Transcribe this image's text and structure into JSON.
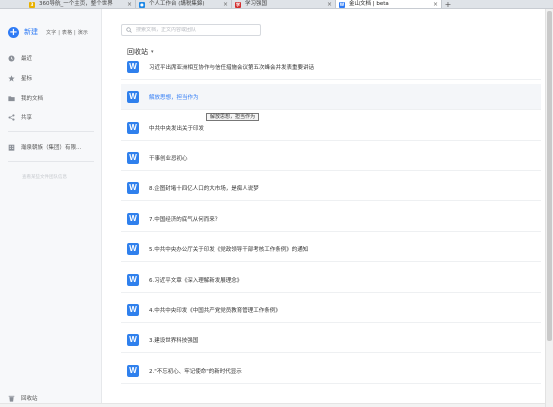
{
  "tabs": [
    {
      "title": "360导航_一个主页，整个世界",
      "active": false,
      "favicon_color": "#e9b100"
    },
    {
      "title": "个人工作台 (講税集錦)",
      "active": false,
      "favicon_color": "#1e88e5"
    },
    {
      "title": "学习强国",
      "active": false,
      "favicon_color": "#d32f2f"
    },
    {
      "title": "金山文档 | beta",
      "active": true,
      "favicon_color": "#2f7bf5"
    }
  ],
  "sidebar": {
    "new_label": "新建",
    "new_sub": "文字 | 表格 | 演示",
    "nav": [
      {
        "label": "最近",
        "icon": "clock-icon"
      },
      {
        "label": "星标",
        "icon": "star-icon"
      },
      {
        "label": "我的文档",
        "icon": "folder-icon"
      },
      {
        "label": "共享",
        "icon": "share-icon"
      }
    ],
    "team": {
      "label": "瀚泉朝族（集团）有限...",
      "icon": "building-icon"
    },
    "faint_note": "查看某些文件团队信息",
    "trash": {
      "label": "回收站",
      "icon": "trash-icon"
    }
  },
  "search": {
    "placeholder": "搜索文档，正文内容或团队"
  },
  "section": {
    "title": "回收站"
  },
  "docs": [
    "习近平出席亚洲相互协作与信任措施会议第五次峰会并发表重要讲话",
    "解放思想，担当作为",
    "中共中央发出关于印发",
    "干事创业忌初心",
    "8.企图封堵十四亿人口的大市场，是痴人说梦",
    "7.中国经济的底气从何而来？",
    "5.中共中央办公厅关于印发《党政领导干部考核工作条例》的通知",
    "6.习近平文章《深入理解新发展理念》",
    "4.中共中央印发《中国共产党党员教育管理工作条例》",
    "3.建设世界科技强国",
    "2.\"不忘初心、牢记使命\"的新时代显示"
  ],
  "hover_index": 1,
  "tooltip": "解放思想，担当作为",
  "colors": {
    "accent": "#2f7bf5",
    "doc_icon": "#2f80ed"
  }
}
